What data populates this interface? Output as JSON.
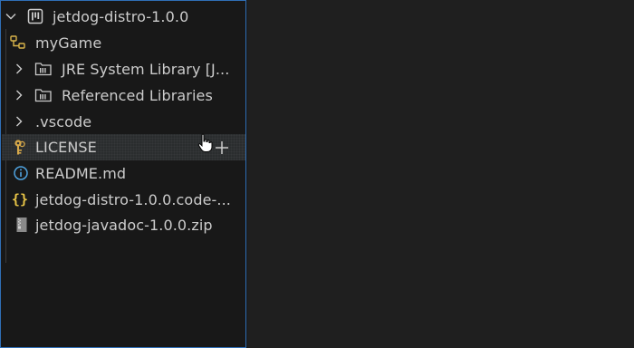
{
  "explorer": {
    "project": {
      "label": "jetdog-distro-1.0.0",
      "icon": "project-icon",
      "expanded": true
    },
    "items": [
      {
        "label": "myGame",
        "icon": "tree-node-icon"
      },
      {
        "label": "JRE System Library [J...",
        "icon": "library-folder-icon",
        "collapsed": true
      },
      {
        "label": "Referenced Libraries",
        "icon": "library-folder-icon",
        "collapsed": true
      },
      {
        "label": ".vscode",
        "icon": "",
        "collapsed": true
      },
      {
        "label": "LICENSE",
        "icon": "license-key-icon",
        "hovered": true
      },
      {
        "label": "README.md",
        "icon": "info-icon"
      },
      {
        "label": "jetdog-distro-1.0.0.code-...",
        "icon": "json-braces-icon"
      },
      {
        "label": "jetdog-javadoc-1.0.0.zip",
        "icon": "zip-archive-icon"
      }
    ],
    "hover_action": {
      "icon": "plus-icon"
    }
  },
  "colors": {
    "focus_border": "#2f6fb6",
    "json_icon": "#e8c547",
    "license_icon": "#d6a84a",
    "info_icon": "#4fa3e0",
    "text": "#cccccc",
    "background": "#181818"
  }
}
